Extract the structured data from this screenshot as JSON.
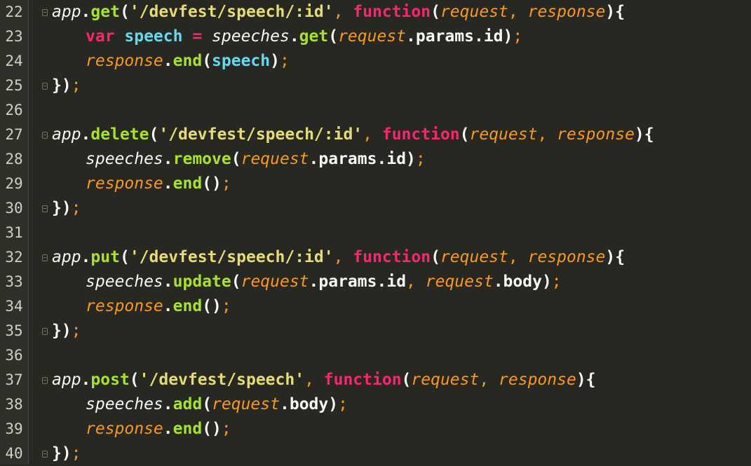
{
  "editor": {
    "lines": [
      {
        "num": "22",
        "fold": true,
        "indent": 0,
        "tokens": [
          [
            "obj",
            "app"
          ],
          [
            "punc",
            "."
          ],
          [
            "meth",
            "get"
          ],
          [
            "punc",
            "("
          ],
          [
            "str",
            "'/devfest/speech/:id'"
          ],
          [
            "comma",
            ", "
          ],
          [
            "kw",
            "function"
          ],
          [
            "punc",
            "("
          ],
          [
            "param",
            "request"
          ],
          [
            "comma",
            ", "
          ],
          [
            "param",
            "response"
          ],
          [
            "punc",
            "){"
          ]
        ]
      },
      {
        "num": "23",
        "fold": false,
        "indent": 1,
        "tokens": [
          [
            "kw",
            "var "
          ],
          [
            "var",
            "speech"
          ],
          [
            "op",
            " = "
          ],
          [
            "obj",
            "speeches"
          ],
          [
            "punc",
            "."
          ],
          [
            "meth",
            "get"
          ],
          [
            "punc",
            "("
          ],
          [
            "param",
            "request"
          ],
          [
            "punc",
            "."
          ],
          [
            "plain",
            "params"
          ],
          [
            "punc",
            "."
          ],
          [
            "plain",
            "id"
          ],
          [
            "punc",
            ")"
          ],
          [
            "semi",
            ";"
          ]
        ]
      },
      {
        "num": "24",
        "fold": false,
        "indent": 1,
        "tokens": [
          [
            "param",
            "response"
          ],
          [
            "punc",
            "."
          ],
          [
            "meth",
            "end"
          ],
          [
            "punc",
            "("
          ],
          [
            "var",
            "speech"
          ],
          [
            "punc",
            ")"
          ],
          [
            "semi",
            ";"
          ]
        ]
      },
      {
        "num": "25",
        "fold": true,
        "indent": 0,
        "tokens": [
          [
            "punc",
            "})"
          ],
          [
            "semi",
            ";"
          ]
        ]
      },
      {
        "num": "26",
        "fold": false,
        "indent": 0,
        "tokens": []
      },
      {
        "num": "27",
        "fold": true,
        "indent": 0,
        "tokens": [
          [
            "obj",
            "app"
          ],
          [
            "punc",
            "."
          ],
          [
            "meth",
            "delete"
          ],
          [
            "punc",
            "("
          ],
          [
            "str",
            "'/devfest/speech/:id'"
          ],
          [
            "comma",
            ", "
          ],
          [
            "kw",
            "function"
          ],
          [
            "punc",
            "("
          ],
          [
            "param",
            "request"
          ],
          [
            "comma",
            ", "
          ],
          [
            "param",
            "response"
          ],
          [
            "punc",
            "){"
          ]
        ]
      },
      {
        "num": "28",
        "fold": false,
        "indent": 1,
        "tokens": [
          [
            "obj",
            "speeches"
          ],
          [
            "punc",
            "."
          ],
          [
            "meth",
            "remove"
          ],
          [
            "punc",
            "("
          ],
          [
            "param",
            "request"
          ],
          [
            "punc",
            "."
          ],
          [
            "plain",
            "params"
          ],
          [
            "punc",
            "."
          ],
          [
            "plain",
            "id"
          ],
          [
            "punc",
            ")"
          ],
          [
            "semi",
            ";"
          ]
        ]
      },
      {
        "num": "29",
        "fold": false,
        "indent": 1,
        "tokens": [
          [
            "param",
            "response"
          ],
          [
            "punc",
            "."
          ],
          [
            "meth",
            "end"
          ],
          [
            "punc",
            "()"
          ],
          [
            "semi",
            ";"
          ]
        ]
      },
      {
        "num": "30",
        "fold": true,
        "indent": 0,
        "tokens": [
          [
            "punc",
            "})"
          ],
          [
            "semi",
            ";"
          ]
        ]
      },
      {
        "num": "31",
        "fold": false,
        "indent": 0,
        "tokens": []
      },
      {
        "num": "32",
        "fold": true,
        "indent": 0,
        "tokens": [
          [
            "obj",
            "app"
          ],
          [
            "punc",
            "."
          ],
          [
            "meth",
            "put"
          ],
          [
            "punc",
            "("
          ],
          [
            "str",
            "'/devfest/speech/:id'"
          ],
          [
            "comma",
            ", "
          ],
          [
            "kw",
            "function"
          ],
          [
            "punc",
            "("
          ],
          [
            "param",
            "request"
          ],
          [
            "comma",
            ", "
          ],
          [
            "param",
            "response"
          ],
          [
            "punc",
            "){"
          ]
        ]
      },
      {
        "num": "33",
        "fold": false,
        "indent": 1,
        "tokens": [
          [
            "obj",
            "speeches"
          ],
          [
            "punc",
            "."
          ],
          [
            "meth",
            "update"
          ],
          [
            "punc",
            "("
          ],
          [
            "param",
            "request"
          ],
          [
            "punc",
            "."
          ],
          [
            "plain",
            "params"
          ],
          [
            "punc",
            "."
          ],
          [
            "plain",
            "id"
          ],
          [
            "comma",
            ", "
          ],
          [
            "param",
            "request"
          ],
          [
            "punc",
            "."
          ],
          [
            "plain",
            "body"
          ],
          [
            "punc",
            ")"
          ],
          [
            "semi",
            ";"
          ]
        ]
      },
      {
        "num": "34",
        "fold": false,
        "indent": 1,
        "tokens": [
          [
            "param",
            "response"
          ],
          [
            "punc",
            "."
          ],
          [
            "meth",
            "end"
          ],
          [
            "punc",
            "()"
          ],
          [
            "semi",
            ";"
          ]
        ]
      },
      {
        "num": "35",
        "fold": true,
        "indent": 0,
        "tokens": [
          [
            "punc",
            "})"
          ],
          [
            "semi",
            ";"
          ]
        ]
      },
      {
        "num": "36",
        "fold": false,
        "indent": 0,
        "tokens": []
      },
      {
        "num": "37",
        "fold": true,
        "indent": 0,
        "tokens": [
          [
            "obj",
            "app"
          ],
          [
            "punc",
            "."
          ],
          [
            "meth",
            "post"
          ],
          [
            "punc",
            "("
          ],
          [
            "str",
            "'/devfest/speech'"
          ],
          [
            "comma",
            ", "
          ],
          [
            "kw",
            "function"
          ],
          [
            "punc",
            "("
          ],
          [
            "param",
            "request"
          ],
          [
            "comma",
            ", "
          ],
          [
            "param",
            "response"
          ],
          [
            "punc",
            "){"
          ]
        ]
      },
      {
        "num": "38",
        "fold": false,
        "indent": 1,
        "tokens": [
          [
            "obj",
            "speeches"
          ],
          [
            "punc",
            "."
          ],
          [
            "meth",
            "add"
          ],
          [
            "punc",
            "("
          ],
          [
            "param",
            "request"
          ],
          [
            "punc",
            "."
          ],
          [
            "plain",
            "body"
          ],
          [
            "punc",
            ")"
          ],
          [
            "semi",
            ";"
          ]
        ]
      },
      {
        "num": "39",
        "fold": false,
        "indent": 1,
        "tokens": [
          [
            "param",
            "response"
          ],
          [
            "punc",
            "."
          ],
          [
            "meth",
            "end"
          ],
          [
            "punc",
            "()"
          ],
          [
            "semi",
            ";"
          ]
        ]
      },
      {
        "num": "40",
        "fold": true,
        "indent": 0,
        "tokens": [
          [
            "punc",
            "})"
          ],
          [
            "semi",
            ";"
          ]
        ]
      }
    ]
  },
  "theme": {
    "background": "#272822",
    "keyword": "#f92672",
    "string": "#e6db74",
    "method": "#a6e22e",
    "parameter": "#fd971f",
    "variable": "#66d9ef",
    "plain": "#f8f8f2"
  }
}
